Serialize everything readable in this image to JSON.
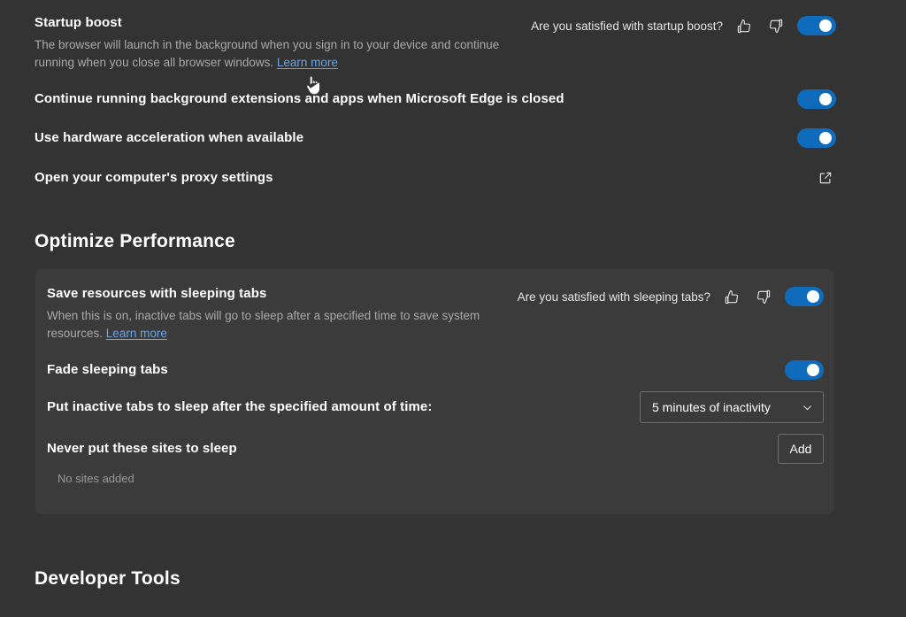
{
  "theme": {
    "page_bg": "#333333",
    "card_bg": "#3b3b3b",
    "accent_toggle": "#0f6cbd",
    "link_color": "#6ba3de",
    "text_primary": "#ffffff",
    "text_secondary": "#a9a9a9",
    "border_color": "#6e6e6e"
  },
  "system_section": {
    "startup_boost": {
      "title": "Startup boost",
      "description_part1": "The browser will launch in the background when you sign in to your device and continue running when you close all browser windows.",
      "learn_more": "Learn more",
      "feedback_question": "Are you satisfied with startup boost?",
      "thumbs_up_icon": "thumbs-up-icon",
      "thumbs_down_icon": "thumbs-down-icon",
      "toggle_state": "on"
    },
    "background_extensions": {
      "title": "Continue running background extensions and apps when Microsoft Edge is closed",
      "toggle_state": "on"
    },
    "hardware_acceleration": {
      "title": "Use hardware acceleration when available",
      "toggle_state": "on"
    },
    "proxy_settings": {
      "title": "Open your computer's proxy settings",
      "action_icon": "external-link-icon"
    }
  },
  "optimize_performance": {
    "heading": "Optimize Performance",
    "sleeping_tabs": {
      "title": "Save resources with sleeping tabs",
      "description_part1": "When this is on, inactive tabs will go to sleep after a specified time to save system resources.",
      "learn_more": "Learn more",
      "feedback_question": "Are you satisfied with sleeping tabs?",
      "thumbs_up_icon": "thumbs-up-icon",
      "thumbs_down_icon": "thumbs-down-icon",
      "toggle_state": "on"
    },
    "fade_sleeping_tabs": {
      "title": "Fade sleeping tabs",
      "toggle_state": "on"
    },
    "inactive_timeout": {
      "title": "Put inactive tabs to sleep after the specified amount of time:",
      "selected_option": "5 minutes of inactivity",
      "chevron_icon": "chevron-down-icon"
    },
    "never_sleep_sites": {
      "title": "Never put these sites to sleep",
      "add_button": "Add",
      "empty_state": "No sites added"
    }
  },
  "developer_tools": {
    "heading": "Developer Tools"
  },
  "pointer": {
    "icon": "hand-pointer-cursor"
  }
}
